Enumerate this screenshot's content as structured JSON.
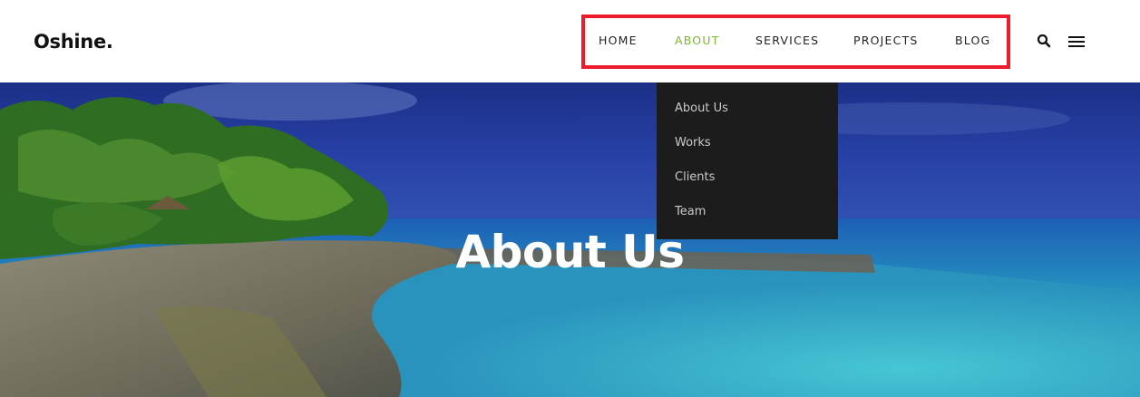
{
  "header": {
    "logo": "Oshine."
  },
  "nav": {
    "items": [
      {
        "label": "HOME",
        "active": false
      },
      {
        "label": "ABOUT",
        "active": true
      },
      {
        "label": "SERVICES",
        "active": false
      },
      {
        "label": "PROJECTS",
        "active": false
      },
      {
        "label": "BLOG",
        "active": false
      }
    ],
    "active_color": "#7cb531",
    "highlight_color": "#ee1c2a"
  },
  "icons": {
    "search": "search-icon",
    "menu": "hamburger-menu-icon"
  },
  "dropdown": {
    "items": [
      "About Us",
      "Works",
      "Clients",
      "Team"
    ]
  },
  "hero": {
    "title": "About Us"
  }
}
